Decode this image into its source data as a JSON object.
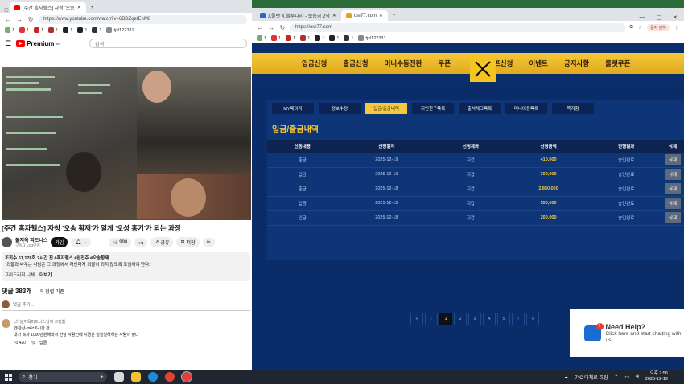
{
  "youtube_window": {
    "tabs": [
      {
        "label": "[주간 흑자헬스] 자청 '오송",
        "active": true
      },
      {
        "label": "+",
        "active": false
      }
    ],
    "url": "https://www.youtube.com/watch?v=6BDZqetEnM8",
    "bookmarks": [
      "1",
      "1",
      "1",
      "1",
      "1",
      "1",
      "1",
      "tjsl122331"
    ],
    "logo": "Premium",
    "logo_sup": "KR",
    "search_placeholder": "검색",
    "video_title": "[주간 흑자헬스] 자청 '오송 황제'가 일게 '오성 홍기'가 되는 과정",
    "channel_name": "불지옥 피트니스",
    "subscribers": "구독자 13.3만명",
    "join_label": "가입",
    "like_count": "998",
    "share_label": "공유",
    "save_label": "저장",
    "desc_meta": "조회수 61,176회 7시간 전 #흑자헬스 #완전주 #오송황제",
    "desc_line": "\"괴물과 싸우는 사람은 그 과정에서 자신마저 괴물이 되지 않도록 조심해야 한다.\"",
    "desc_more_label": "...더보기",
    "desc_owner": "프리드리히 니체",
    "comments_count": "댓글 383개",
    "sort_label": "정렬 기준",
    "add_comment_placeholder": "댓글 추가...",
    "pinned_by": "불지옥피트니스님이 고정함",
    "comment_author": "@완산-m6z 6시간 전",
    "comment_text": "내가 흑자 1000만원해봐서 한달 사람인데 지금은 얼얼얼해하는 사람이 됐다",
    "comment_likes": "420",
    "reply_label": "답글"
  },
  "site_window": {
    "tabs": [
      {
        "label": "X플랫 X 블루나라 - 보증금 2억",
        "active": false
      },
      {
        "label": "osr77.com",
        "active": true
      },
      {
        "label": "+",
        "active": false
      }
    ],
    "url": "https://osr77.com",
    "bookmarks": [
      "1",
      "1",
      "1",
      "1",
      "1",
      "1",
      "1",
      "tjsl122331"
    ],
    "profile_label": "문자 안하",
    "nav_items": [
      "입금신청",
      "출금신청",
      "머니수동전환",
      "쿠폰",
      "콤프신청",
      "이벤트",
      "공지사항",
      "룰렛쿠폰"
    ],
    "sub_tabs": [
      "MY페이지",
      "정보수정",
      "입금/출금내역",
      "지인친구목록",
      "출석체크목록",
      "머니이동목록",
      "쪽지함"
    ],
    "active_sub_tab": 2,
    "panel_title": "입금/출금내역",
    "table_headers": [
      "신청내용",
      "신청일자",
      "신청계좌",
      "신청금액",
      "진행결과",
      "삭제"
    ],
    "rows": [
      [
        "출금",
        "2025-12-19",
        "지갑",
        "410,000",
        "승인완료",
        "삭제"
      ],
      [
        "입금",
        "2025-12-19",
        "지갑",
        "300,000",
        "승인완료",
        "삭제"
      ],
      [
        "출금",
        "2025-12-18",
        "지갑",
        "2,850,000",
        "승인완료",
        "삭제"
      ],
      [
        "입금",
        "2025-12-18",
        "지갑",
        "550,000",
        "승인완료",
        "삭제"
      ],
      [
        "입금",
        "2025-12-18",
        "지갑",
        "200,000",
        "승인완료",
        "삭제"
      ]
    ],
    "pager": [
      "«",
      "‹",
      "1",
      "2",
      "3",
      "4",
      "5",
      "›",
      "»"
    ],
    "active_page": 2
  },
  "help_widget": {
    "badge": "1",
    "title": "Need Help?",
    "text": "Click here and start chatting with us!"
  },
  "taskbar": {
    "search_label": "찾기",
    "weather": "7°C 대체로 흐림",
    "time": "오후 7:56",
    "date": "2025-12-19"
  },
  "colors": {
    "site_bg": "#0b2e6b",
    "accent_gold": "#f5c93a",
    "youtube_red": "#ff0000"
  }
}
